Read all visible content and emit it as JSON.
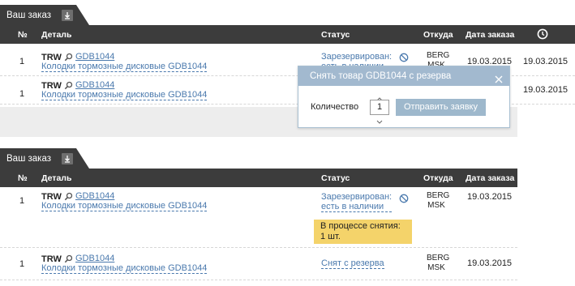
{
  "panel1": {
    "tab_label": "Ваш заказ",
    "columns": {
      "num": "№",
      "part": "Деталь",
      "status": "Статус",
      "from": "Откуда",
      "date": "Дата заказа"
    },
    "rows": [
      {
        "num": "1",
        "brand": "TRW",
        "code": "GDB1044",
        "description": "Колодки тормозные дисковые GDB1044",
        "status_line1": "Зарезервирован:",
        "status_line2": "есть в наличии",
        "from_line1": "BERG",
        "from_line2": "MSK",
        "date": "19.03.2015",
        "date2": "19.03.2015"
      },
      {
        "num": "1",
        "brand": "TRW",
        "code": "GDB1044",
        "description": "Колодки тормозные дисковые GDB1044",
        "date2": "19.03.2015"
      }
    ]
  },
  "popup": {
    "title": "Снять товар GDB1044 с резерва",
    "qty_label": "Количество",
    "qty_value": "1",
    "submit_label": "Отправить заявку"
  },
  "panel2": {
    "tab_label": "Ваш заказ",
    "columns": {
      "num": "№",
      "part": "Деталь",
      "status": "Статус",
      "from": "Откуда",
      "date": "Дата заказа"
    },
    "rows": [
      {
        "num": "1",
        "brand": "TRW",
        "code": "GDB1044",
        "description": "Колодки тормозные дисковые GDB1044",
        "status_line1": "Зарезервирован:",
        "status_line2": "есть в наличии",
        "from_line1": "BERG",
        "from_line2": "MSK",
        "date": "19.03.2015",
        "note_line1": "В процессе снятия:",
        "note_line2": "1 шт."
      },
      {
        "num": "1",
        "brand": "TRW",
        "code": "GDB1044",
        "description": "Колодки тормозные дисковые GDB1044",
        "status_line1": "Снят с резерва",
        "from_line1": "BERG",
        "from_line2": "MSK",
        "date": "19.03.2015"
      }
    ]
  },
  "colors": {
    "header_bg": "#3c3c3c",
    "link": "#4a79ad",
    "popup_header": "#a2b9cf",
    "note_bg": "#f4d36a"
  },
  "icons": [
    "download-icon",
    "clock-icon",
    "search-icon",
    "block-icon",
    "close-icon",
    "arrow-up-icon",
    "arrow-down-icon"
  ]
}
